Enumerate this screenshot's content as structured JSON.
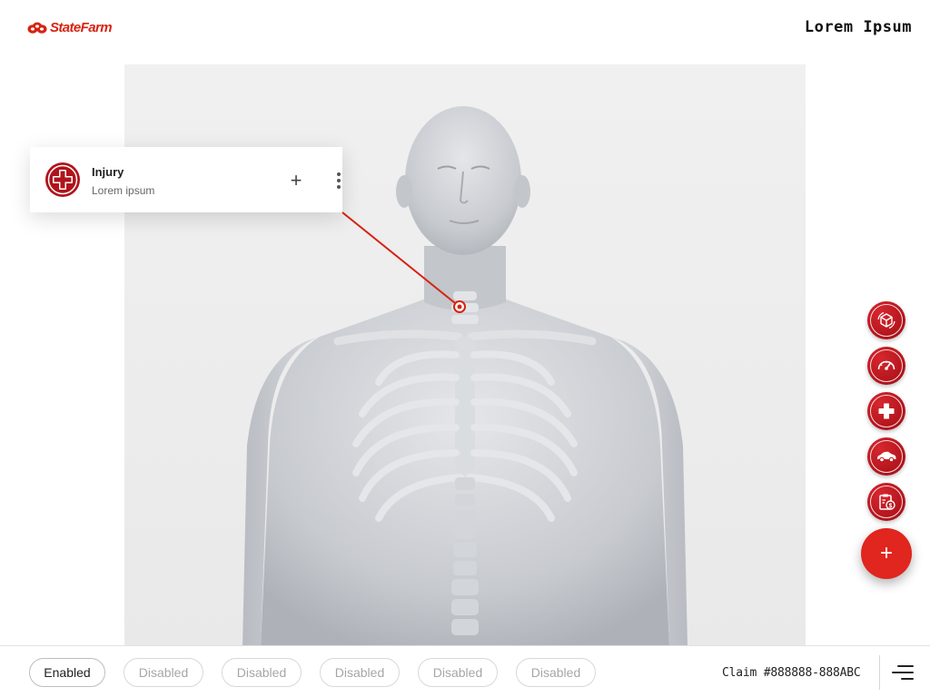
{
  "header": {
    "logo_text": "StateFarm",
    "title": "Lorem Ipsum"
  },
  "callout": {
    "title": "Injury",
    "subtitle": "Lorem ipsum",
    "add_label": "+"
  },
  "toolbar": {
    "items": [
      {
        "name": "cube-rotate-icon"
      },
      {
        "name": "speedometer-icon"
      },
      {
        "name": "medical-cross-icon"
      },
      {
        "name": "car-icon"
      },
      {
        "name": "clipboard-dollar-icon"
      }
    ],
    "fab_label": "+"
  },
  "filters": [
    {
      "label": "Enabled",
      "state": "enabled"
    },
    {
      "label": "Disabled",
      "state": "disabled"
    },
    {
      "label": "Disabled",
      "state": "disabled"
    },
    {
      "label": "Disabled",
      "state": "disabled"
    },
    {
      "label": "Disabled",
      "state": "disabled"
    },
    {
      "label": "Disabled",
      "state": "disabled"
    }
  ],
  "claim": {
    "text": "Claim #888888-888ABC"
  },
  "colors": {
    "accent": "#d62311",
    "icon_red": "#b0141c",
    "body": "#c9ccd0"
  }
}
